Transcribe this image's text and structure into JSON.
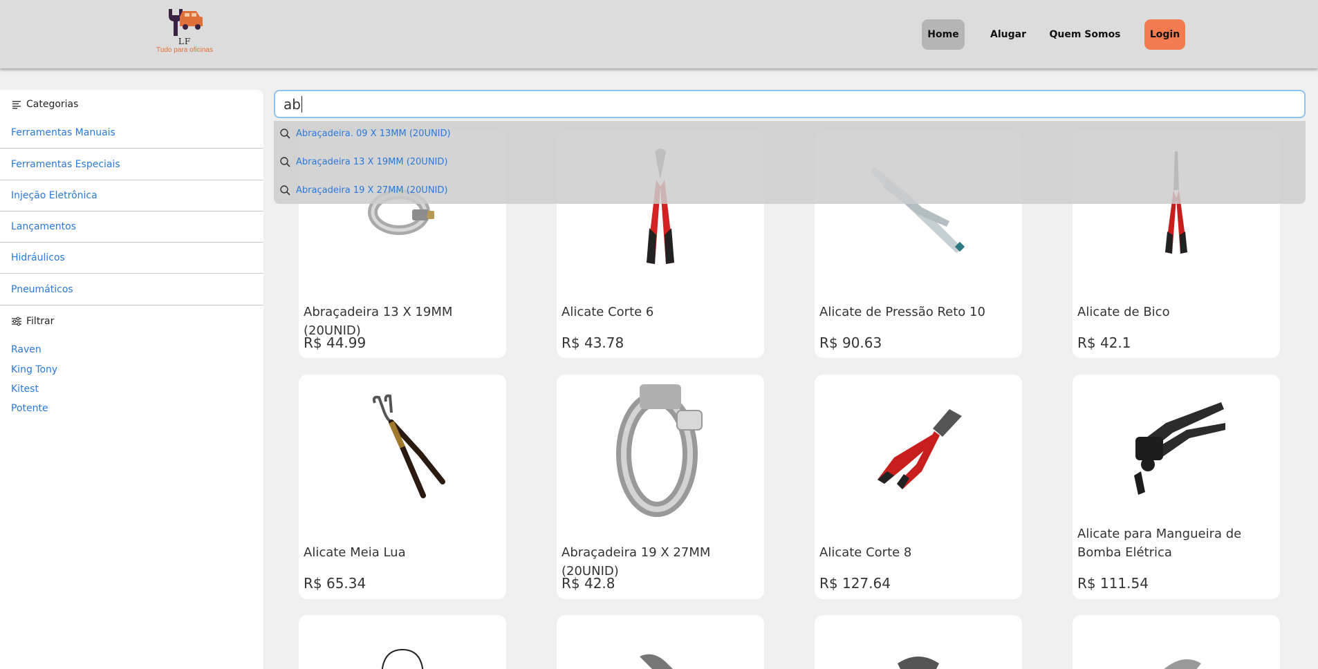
{
  "header": {
    "logo_letters": "LF",
    "logo_tagline": "Tudo para oficinas",
    "nav": [
      {
        "label": "Home"
      },
      {
        "label": "Alugar"
      },
      {
        "label": "Quem Somos"
      },
      {
        "label": "Login"
      }
    ],
    "colors": {
      "header_bg": "#dcdcdc",
      "home_active": "#b5b5b5",
      "login_bg": "#f47a50",
      "logo_orange": "#e0703a"
    }
  },
  "sidebar": {
    "categories_title": "Categorias",
    "categories": [
      {
        "label": "Ferramentas Manuais"
      },
      {
        "label": "Ferramentas Especiais"
      },
      {
        "label": "Injeção Eletrônica"
      },
      {
        "label": "Lançamentos"
      },
      {
        "label": "Hidráulicos"
      },
      {
        "label": "Pneumáticos"
      }
    ],
    "filter_title": "Filtrar",
    "brands": [
      {
        "label": "Raven"
      },
      {
        "label": "King Tony"
      },
      {
        "label": "Kitest"
      },
      {
        "label": "Potente"
      }
    ],
    "link_color": "#2a79d8"
  },
  "search": {
    "value": "ab",
    "suggestions": [
      {
        "label": "Abraçadeira. 09 X 13MM (20UNID)"
      },
      {
        "label": "Abraçadeira 13 X 19MM (20UNID)"
      },
      {
        "label": "Abraçadeira 19 X 27MM (20UNID)"
      }
    ]
  },
  "products": [
    {
      "name": "Abraçadeira 13 X 19MM (20UNID)",
      "price": "R$ 44.99",
      "icon": "hose-clamp-small-icon"
    },
    {
      "name": "Alicate Corte 6",
      "price": "R$ 43.78",
      "icon": "diagonal-cutter-icon"
    },
    {
      "name": "Alicate de Pressão Reto 10",
      "price": "R$ 90.63",
      "icon": "locking-pliers-icon"
    },
    {
      "name": "Alicate de Bico",
      "price": "R$ 42.1",
      "icon": "needle-nose-pliers-icon"
    },
    {
      "name": "Alicate Meia Lua",
      "price": "R$ 65.34",
      "icon": "bent-nose-pliers-icon"
    },
    {
      "name": "Abraçadeira 19 X 27MM (20UNID)",
      "price": "R$ 42.8",
      "icon": "hose-clamp-large-icon"
    },
    {
      "name": "Alicate Corte 8",
      "price": "R$ 127.64",
      "icon": "diagonal-cutter-8-icon"
    },
    {
      "name": "Alicate para Mangueira de Bomba Elétrica",
      "price": "R$ 111.54",
      "icon": "hose-pliers-icon"
    },
    {
      "name": "",
      "price": "",
      "icon": "pliers-partial-icon"
    },
    {
      "name": "",
      "price": "",
      "icon": "pliers-partial-icon"
    },
    {
      "name": "",
      "price": "",
      "icon": "pliers-partial-icon"
    },
    {
      "name": "",
      "price": "",
      "icon": "pliers-partial-icon"
    }
  ]
}
